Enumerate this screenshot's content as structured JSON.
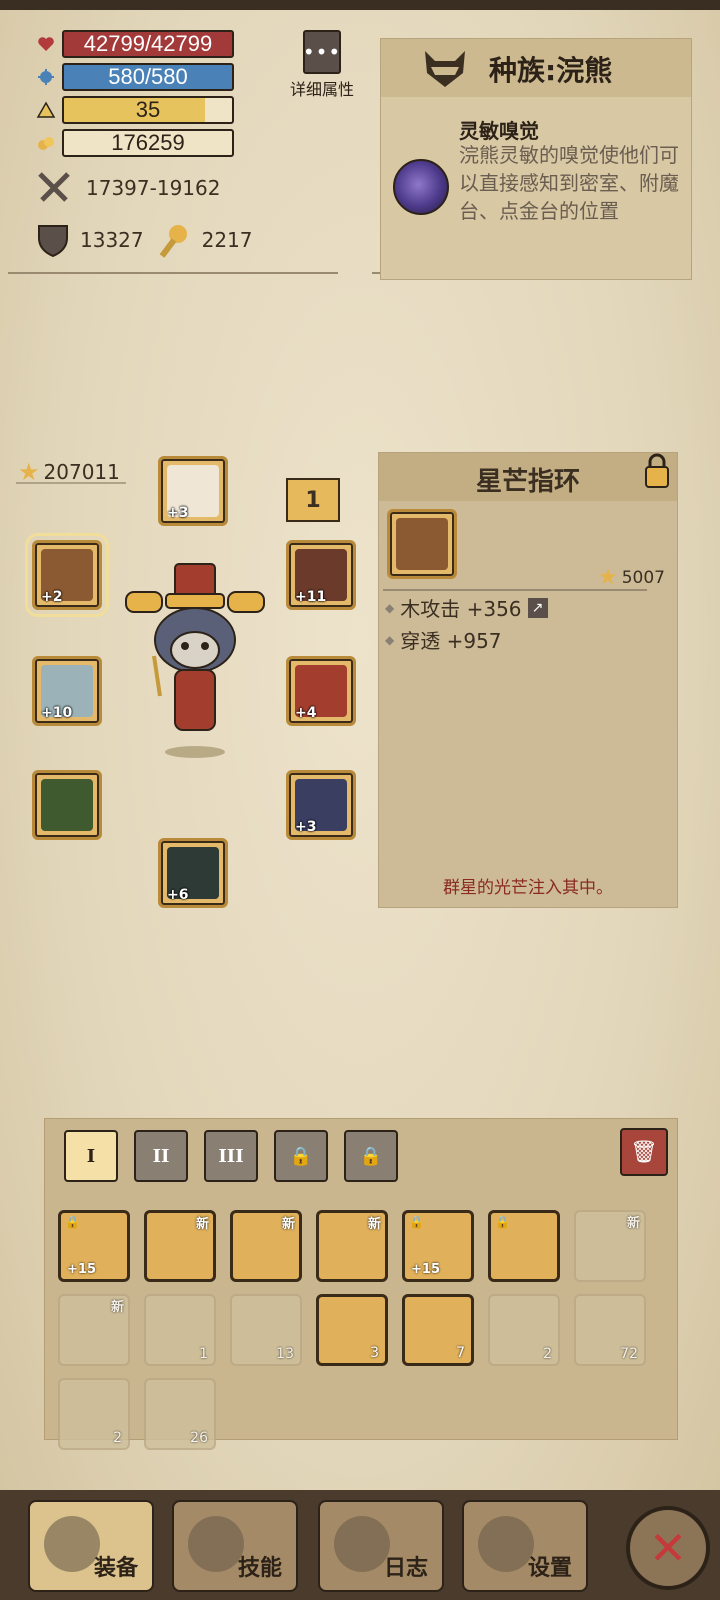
{
  "stats": {
    "hp": "42799/42799",
    "mp": "580/580",
    "level": "35",
    "gold": "176259",
    "attack": "17397-19162",
    "defense": "13327",
    "luck": "2217"
  },
  "detail_button": {
    "label": "详细属性",
    "dots": "•••"
  },
  "race": {
    "title": "种族:浣熊",
    "skill_name": "灵敏嗅觉",
    "skill_desc": "浣熊灵敏的嗅觉使他们可以直接感知到密室、附魔台、点金台的位置"
  },
  "equipment": {
    "power": "207011",
    "tag_one": "1",
    "slots": [
      {
        "name": "helmet",
        "level": "+3"
      },
      {
        "name": "ring",
        "level": "+2"
      },
      {
        "name": "amulet",
        "level": "+11"
      },
      {
        "name": "weapon",
        "level": "+10"
      },
      {
        "name": "armor",
        "level": "+4"
      },
      {
        "name": "gloves",
        "level": ""
      },
      {
        "name": "pants",
        "level": "+3"
      },
      {
        "name": "boots",
        "level": "+6"
      }
    ]
  },
  "item_detail": {
    "title": "星芒指环",
    "score": "5007",
    "stat1": "木攻击 +356",
    "stat2": "穿透 +957",
    "flavor": "群星的光芒注入其中。"
  },
  "inventory": {
    "tabs": [
      "I",
      "II",
      "III"
    ],
    "locked_tabs": 2,
    "rows": [
      [
        {
          "type": "gold",
          "level": "+15",
          "locked": true
        },
        {
          "type": "gold",
          "new": "新"
        },
        {
          "type": "gold",
          "new": "新"
        },
        {
          "type": "gold",
          "new": "新"
        },
        {
          "type": "gold",
          "level": "+15",
          "locked": true
        },
        {
          "type": "gold",
          "locked": true
        },
        {
          "type": "dim",
          "new": "新"
        }
      ],
      [
        {
          "type": "dim",
          "new": "新"
        },
        {
          "type": "dim",
          "count": "1"
        },
        {
          "type": "dim",
          "count": "13"
        },
        {
          "type": "gold",
          "count": "3"
        },
        {
          "type": "gold",
          "count": "7"
        },
        {
          "type": "dim",
          "count": "2"
        },
        {
          "type": "dim",
          "count": "72"
        }
      ],
      [
        {
          "type": "dim",
          "count": "2"
        },
        {
          "type": "dim",
          "count": "26"
        }
      ]
    ]
  },
  "nav": {
    "equip": "装备",
    "skills": "技能",
    "log": "日志",
    "settings": "设置",
    "close": "✕"
  },
  "colors": {
    "hp": "#a23a3a",
    "mp": "#4a82b8",
    "level": "#e6c35c",
    "accent": "#e0b05a"
  }
}
